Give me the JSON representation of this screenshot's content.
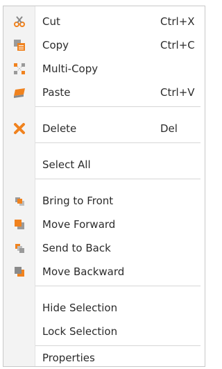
{
  "menu": {
    "cut": {
      "label": "Cut",
      "shortcut": "Ctrl+X",
      "icon": "scissors-icon"
    },
    "copy": {
      "label": "Copy",
      "shortcut": "Ctrl+C",
      "icon": "copy-icon"
    },
    "multi_copy": {
      "label": "Multi-Copy",
      "icon": "multi-copy-icon"
    },
    "paste": {
      "label": "Paste",
      "shortcut": "Ctrl+V",
      "icon": "paste-icon"
    },
    "delete": {
      "label": "Delete",
      "shortcut": "Del",
      "icon": "delete-x-icon"
    },
    "select_all": {
      "label": "Select All"
    },
    "bring_to_front": {
      "label": "Bring to Front",
      "icon": "bring-to-front-icon"
    },
    "move_forward": {
      "label": "Move Forward",
      "icon": "move-forward-icon"
    },
    "send_to_back": {
      "label": "Send to Back",
      "icon": "send-to-back-icon"
    },
    "move_backward": {
      "label": "Move Backward",
      "icon": "move-backward-icon"
    },
    "hide_selection": {
      "label": "Hide Selection"
    },
    "lock_selection": {
      "label": "Lock Selection"
    },
    "properties": {
      "label": "Properties"
    }
  },
  "colors": {
    "orange": "#f0821e",
    "gray": "#8a8a8a",
    "gutter": "#f3f3f3"
  }
}
